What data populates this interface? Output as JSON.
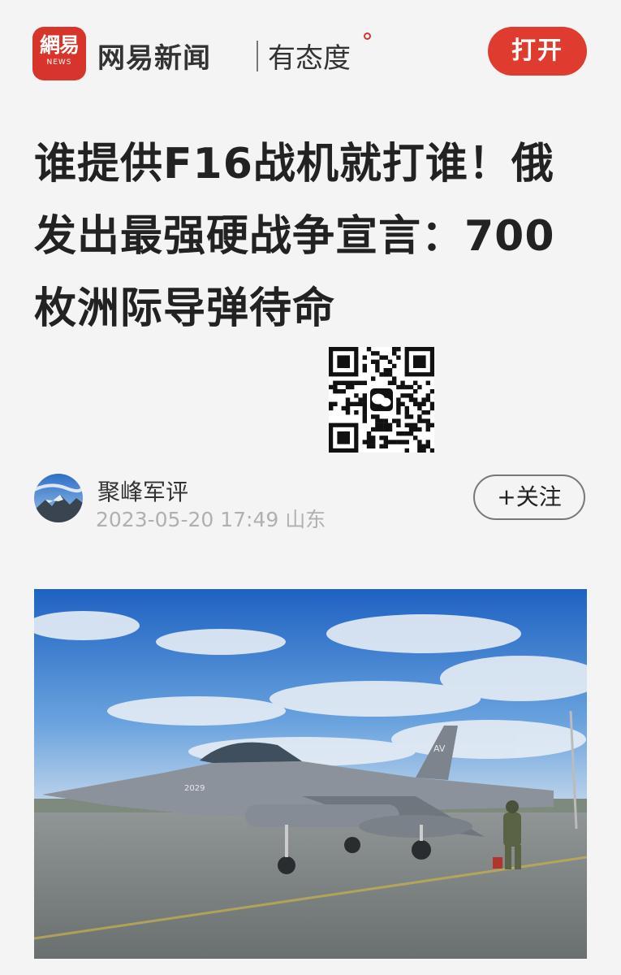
{
  "header": {
    "logo_text_main": "網易",
    "logo_text_sub": "NEWS",
    "brand": "网易新闻",
    "slogan": "有态度",
    "open_button": "打开"
  },
  "article": {
    "title": "谁提供F16战机就打谁！俄发出最强硬战争宣言：700枚洲际导弹待命",
    "author": "聚峰军评",
    "date": "2023-05-20 17:49",
    "location": "山东",
    "follow_button": "+关注"
  },
  "image": {
    "aircraft_code": "2029",
    "tail_code": "AV"
  },
  "colors": {
    "brand_red": "#e03b2f",
    "text_dark": "#222222",
    "meta_gray": "#b0b0b0"
  },
  "icons": [
    "netease-news-logo",
    "qr-code-icon",
    "wechat-icon",
    "author-avatar"
  ]
}
